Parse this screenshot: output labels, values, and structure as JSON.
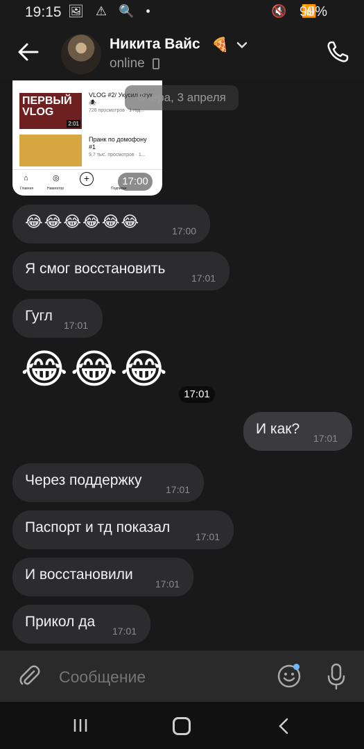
{
  "status_bar": {
    "time": "19:15",
    "battery": "99%"
  },
  "header": {
    "name": "Никита Вайс",
    "name_emoji": "🍕",
    "status": "online"
  },
  "chat": {
    "date_chip": "Вчера, 3 апреля",
    "screenshot_message": {
      "time": "17:00",
      "thumb1_text": "ПЕРВЫЙ VLOG",
      "thumb1_duration": "2:01",
      "video1_title": "VLOG #2/ Укусил паук 🕷",
      "video1_meta": "726 просмотров · 1 год...",
      "video2_title": "Пранк по домофону #1",
      "video2_meta": "9,7 тыс. просмотров · 1...",
      "nav_labels": [
        "Главная",
        "Навигатор",
        "",
        "Подписки",
        ""
      ]
    },
    "messages": [
      {
        "text": "😂😂😂😂😂😂",
        "time": "17:00",
        "dir": "in"
      },
      {
        "text": "Я смог восстановить",
        "time": "17:01",
        "dir": "in"
      },
      {
        "text": "Гугл",
        "time": "17:01",
        "dir": "in"
      },
      {
        "text": "😂😂😂",
        "time": "17:01",
        "dir": "in",
        "big": true
      },
      {
        "text": "И как?",
        "time": "17:01",
        "dir": "out"
      },
      {
        "text": "Через поддержку",
        "time": "17:01",
        "dir": "in"
      },
      {
        "text": "Паспорт и тд показал",
        "time": "17:01",
        "dir": "in"
      },
      {
        "text": "И восстановили",
        "time": "17:01",
        "dir": "in"
      },
      {
        "text": "Прикол да",
        "time": "17:01",
        "dir": "in"
      }
    ]
  },
  "composer": {
    "placeholder": "Сообщение"
  },
  "colors": {
    "bubble_in": "#2c2c2e",
    "bubble_out": "#3b3b3d",
    "background": "#191919",
    "accent_dot": "#6eb6ff"
  }
}
